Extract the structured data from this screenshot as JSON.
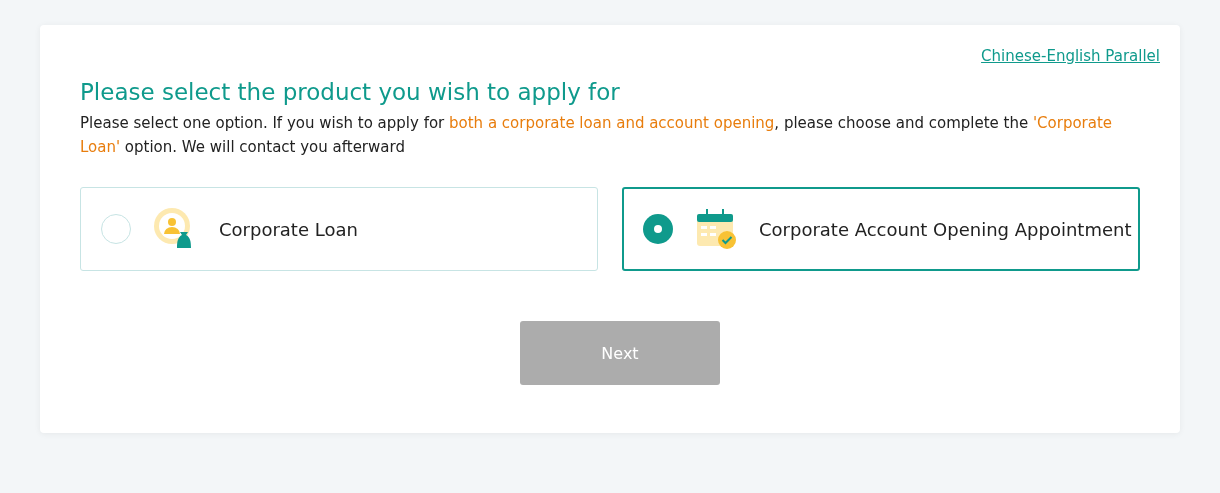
{
  "language_link": "Chinese-English Parallel",
  "title": "Please select the product you wish to apply for",
  "description": [
    {
      "text": "Please select one option. If you wish to apply for ",
      "highlight": false
    },
    {
      "text": "both a corporate loan and account opening",
      "highlight": true
    },
    {
      "text": ", please choose and complete the ",
      "highlight": false
    },
    {
      "text": "'Corporate Loan'",
      "highlight": true
    },
    {
      "text": " option. We will contact you afterward",
      "highlight": false
    }
  ],
  "options": [
    {
      "label": "Corporate Loan",
      "kind": "loan",
      "selected": false
    },
    {
      "label": "Corporate Account Opening Appointment",
      "kind": "calendar",
      "selected": true
    }
  ],
  "next_button": {
    "label": "Next",
    "disabled": true
  }
}
